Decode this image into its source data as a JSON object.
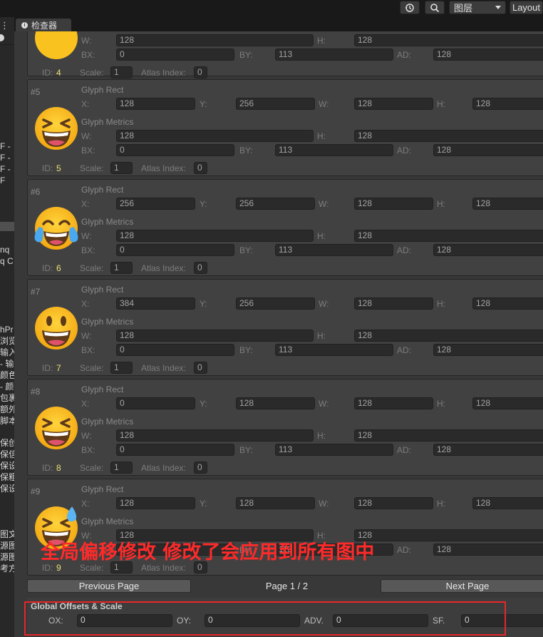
{
  "toolbar": {
    "history_icon": "history-icon",
    "search_icon": "search-icon",
    "layers_label": "图层",
    "layout_label": "Layout"
  },
  "left_panel_fragments": [
    "F -",
    "F -",
    "F -",
    "F",
    "nq",
    "q C",
    "hPr",
    "浏览",
    "输入",
    "- 输",
    "颜色",
    "- 颜",
    "包裹",
    "额外",
    "脚本",
    "保创",
    "保信",
    "保设",
    "保粗",
    "保设",
    "图文",
    "源图",
    "源图",
    "考方"
  ],
  "inspector_tab": {
    "label": "检查器",
    "icon": "info-icon"
  },
  "colors": {
    "accent_value": "#ece075",
    "annotation": "#ff2a2a"
  },
  "labels": {
    "glyph_rect": "Glyph Rect",
    "glyph_metrics": "Glyph Metrics",
    "x": "X:",
    "y": "Y:",
    "w": "W:",
    "h": "H:",
    "bx": "BX:",
    "by": "BY:",
    "ad": "AD:",
    "id": "ID:",
    "scale": "Scale:",
    "atlas_index": "Atlas Index:"
  },
  "partial_card": {
    "w": "128",
    "h": "128",
    "bx": "0",
    "by": "113",
    "ad": "128",
    "id": "4",
    "scale": "1",
    "atlas_index": "0"
  },
  "glyphs": [
    {
      "num": "#5",
      "emoji": "grinning-squinting-face-icon",
      "rect": {
        "x": "128",
        "y": "256",
        "w": "128",
        "h": "128"
      },
      "metrics": {
        "w": "128",
        "h": "128",
        "bx": "0",
        "by": "113",
        "ad": "128"
      },
      "id": "5",
      "scale": "1",
      "atlas_index": "0"
    },
    {
      "num": "#6",
      "emoji": "face-with-tears-of-joy-icon",
      "rect": {
        "x": "256",
        "y": "256",
        "w": "128",
        "h": "128"
      },
      "metrics": {
        "w": "128",
        "h": "128",
        "bx": "0",
        "by": "113",
        "ad": "128"
      },
      "id": "6",
      "scale": "1",
      "atlas_index": "0"
    },
    {
      "num": "#7",
      "emoji": "grinning-face-big-eyes-icon",
      "rect": {
        "x": "384",
        "y": "256",
        "w": "128",
        "h": "128"
      },
      "metrics": {
        "w": "128",
        "h": "128",
        "bx": "0",
        "by": "113",
        "ad": "128"
      },
      "id": "7",
      "scale": "1",
      "atlas_index": "0"
    },
    {
      "num": "#8",
      "emoji": "grinning-squinting-face-icon",
      "rect": {
        "x": "0",
        "y": "128",
        "w": "128",
        "h": "128"
      },
      "metrics": {
        "w": "128",
        "h": "128",
        "bx": "0",
        "by": "113",
        "ad": "128"
      },
      "id": "8",
      "scale": "1",
      "atlas_index": "0"
    },
    {
      "num": "#9",
      "emoji": "grinning-face-with-sweat-icon",
      "rect": {
        "x": "128",
        "y": "128",
        "w": "128",
        "h": "128"
      },
      "metrics": {
        "w": "128",
        "h": "128",
        "bx": "0",
        "by": "113",
        "ad": "128"
      },
      "id": "9",
      "scale": "1",
      "atlas_index": "0"
    }
  ],
  "pagination": {
    "prev_label": "Previous Page",
    "page_label": "Page 1 / 2",
    "next_label": "Next Page"
  },
  "global_offsets": {
    "title": "Global Offsets & Scale",
    "ox_label": "OX:",
    "ox": "0",
    "oy_label": "OY:",
    "oy": "0",
    "adv_label": "ADV.",
    "adv": "0",
    "sf_label": "SF.",
    "sf": "0"
  },
  "annotation": {
    "text": "全局偏移修改 修改了会应用到所有图中"
  }
}
